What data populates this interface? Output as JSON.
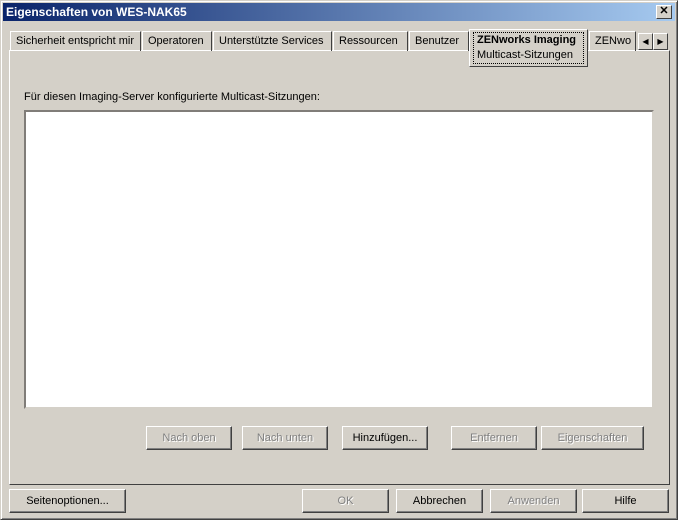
{
  "window": {
    "title": "Eigenschaften von WES-NAK65",
    "close_icon": "close-icon"
  },
  "tabs": [
    {
      "label": "Sicherheit entspricht mir"
    },
    {
      "label": "Operatoren"
    },
    {
      "label": "Unterstützte Services"
    },
    {
      "label": "Ressourcen"
    },
    {
      "label": "Benutzer"
    },
    {
      "label": "ZENworks Imaging",
      "sublabel": "Multicast-Sitzungen",
      "active": true
    },
    {
      "label": "ZENwo"
    }
  ],
  "panel": {
    "list_label": "Für diesen Imaging-Server konfigurierte Multicast-Sitzungen:",
    "buttons": {
      "up": "Nach oben",
      "down": "Nach unten",
      "add": "Hinzufügen...",
      "remove": "Entfernen",
      "properties": "Eigenschaften"
    }
  },
  "footer": {
    "page_options": "Seitenoptionen...",
    "ok": "OK",
    "cancel": "Abbrechen",
    "apply": "Anwenden",
    "help": "Hilfe"
  }
}
